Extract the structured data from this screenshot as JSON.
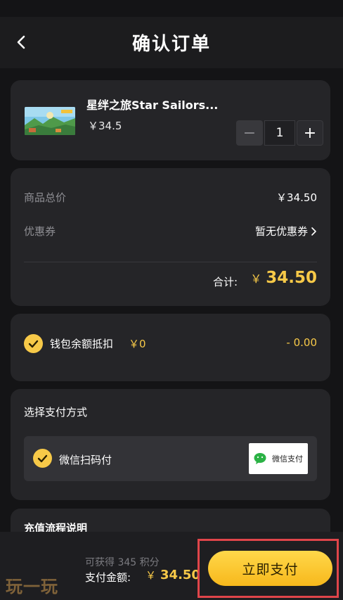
{
  "header": {
    "title": "确认订单"
  },
  "product": {
    "name": "星绊之旅Star Sailors...",
    "price": "￥34.5",
    "quantity": "1",
    "minus_symbol": "−",
    "plus_symbol": "+"
  },
  "pricing": {
    "subtotal_label": "商品总价",
    "subtotal_value": "￥34.50",
    "coupon_label": "优惠券",
    "coupon_value": "暂无优惠券",
    "total_label": "合计:",
    "total_currency": "￥",
    "total_value": "34.50"
  },
  "wallet": {
    "checked": true,
    "label": "钱包余额抵扣",
    "balance": "￥0",
    "deduction": "- 0.00"
  },
  "payment": {
    "title": "选择支付方式",
    "option_label": "微信扫码付",
    "logo_text": "微信支付",
    "checked": true
  },
  "recharge": {
    "title": "充值流程说明"
  },
  "footer": {
    "points_text": "可获得 345 积分",
    "amount_label": "支付金额:",
    "amount_currency": "￥",
    "amount_value": "34.50",
    "pay_button": "立即支付",
    "watermark": "玩一玩"
  },
  "colors": {
    "accent": "#f7c948",
    "background": "#141416",
    "card": "#252528",
    "highlight": "#e0454a",
    "wechat_green": "#2bb245"
  }
}
